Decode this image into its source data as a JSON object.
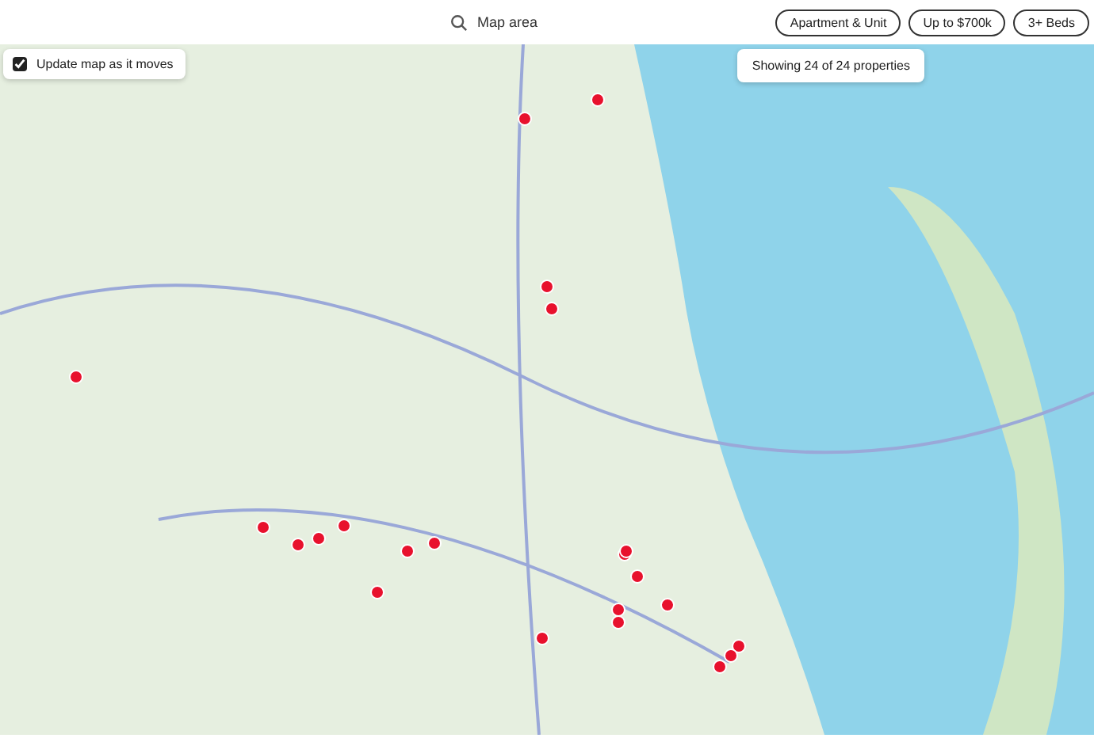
{
  "search": {
    "placeholder": "Map area"
  },
  "filters": [
    {
      "label": "Apartment & Unit"
    },
    {
      "label": "Up to $700k"
    },
    {
      "label": "3+ Beds"
    }
  ],
  "map_toggle": {
    "label": "Update map as it moves",
    "checked": true
  },
  "result_count": "Showing 24 of 24 properties"
}
